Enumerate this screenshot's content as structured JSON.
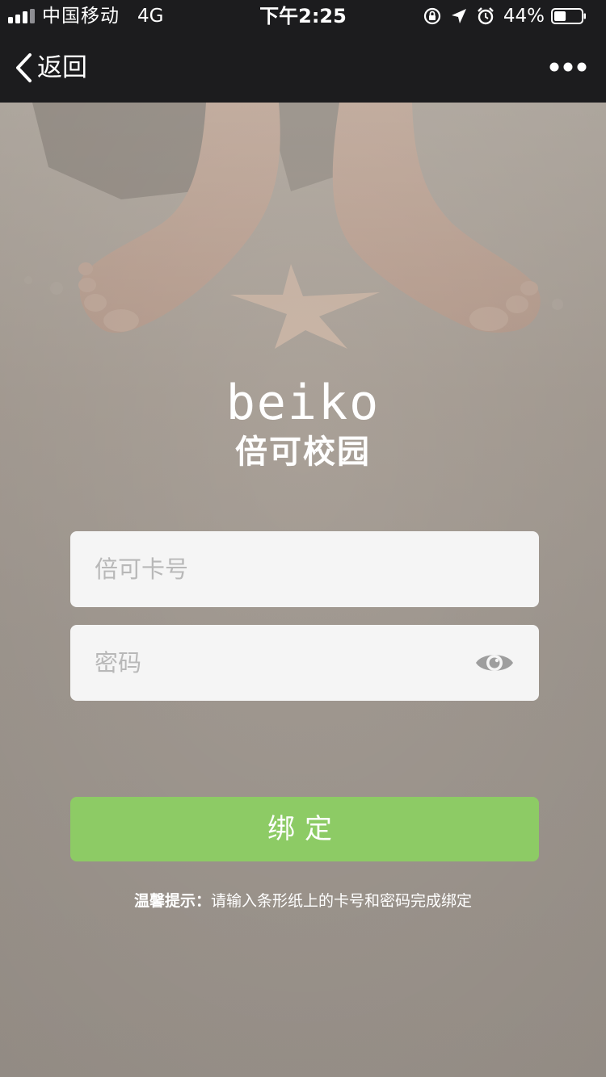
{
  "status_bar": {
    "carrier": "中国移动",
    "network": "4G",
    "time": "下午2:25",
    "battery_percent": "44%",
    "battery_level": 0.44,
    "icons": [
      "signal-icon",
      "orientation-lock-icon",
      "location-icon",
      "alarm-icon",
      "battery-icon"
    ]
  },
  "nav": {
    "back_label": "返回",
    "back_icon": "chevron-left-icon",
    "more_icon": "more-dots-icon"
  },
  "logo": {
    "en": "beiko",
    "cn": "倍可校园"
  },
  "form": {
    "card_placeholder": "倍可卡号",
    "password_placeholder": "密码",
    "eye_icon": "eye-icon",
    "submit_label": "绑定"
  },
  "tip": {
    "prefix": "温馨提示：",
    "text": "请输入条形纸上的卡号和密码完成绑定"
  },
  "colors": {
    "nav_bg": "#1c1c1e",
    "button_bg": "#8dcb65",
    "field_bg": "#f5f5f5",
    "placeholder": "#b8b8b8"
  }
}
